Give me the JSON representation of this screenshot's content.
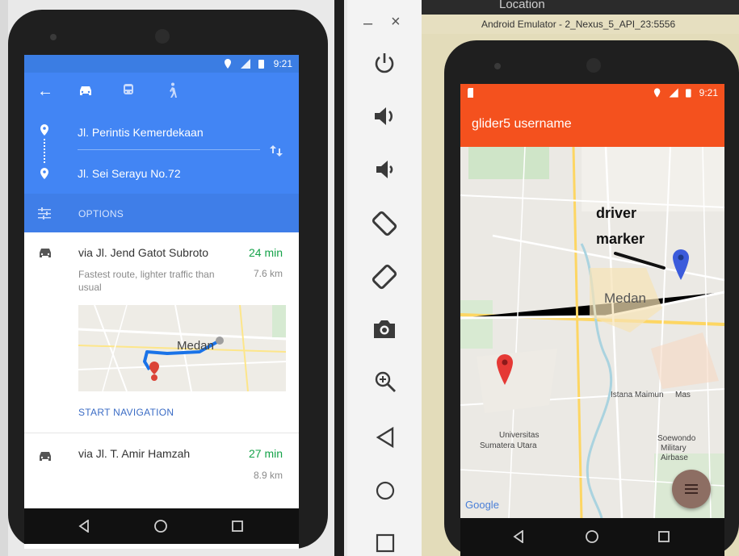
{
  "left_phone": {
    "status_time": "9:21",
    "modes": [
      "car-icon",
      "transit-icon",
      "walk-icon"
    ],
    "origin": "Jl. Perintis Kemerdekaan",
    "destination": "Jl. Sei Serayu No.72",
    "options_label": "OPTIONS",
    "routes": [
      {
        "title": "via Jl. Jend Gatot Subroto",
        "duration": "24 min",
        "desc": "Fastest route, lighter traffic than usual",
        "distance": "7.6 km"
      },
      {
        "title": "via Jl. T. Amir Hamzah",
        "duration": "27 min",
        "distance": "8.9 km"
      }
    ],
    "map_label": "Medan",
    "start_navigation": "START NAVIGATION"
  },
  "panel": {
    "minimize": "–",
    "close": "×"
  },
  "emulator": {
    "window_title": "Android Emulator - 2_Nexus_5_API_23:5556",
    "behind_text": "Location",
    "status_time": "9:21",
    "app_title": "glider5 username",
    "annotation_line1": "driver",
    "annotation_line2": "marker",
    "map_city": "Medan",
    "poi_istana": "Istana Maimun",
    "poi_mas": "Mas",
    "poi_univ_1": "Universitas",
    "poi_univ_2": "Sumatera Utara",
    "poi_air_1": "Soewondo",
    "poi_air_2": "Military",
    "poi_air_3": "Airbase",
    "google": "Google"
  },
  "colors": {
    "blue": "#4285f4",
    "orange": "#f4511e",
    "green": "#16a34a"
  }
}
